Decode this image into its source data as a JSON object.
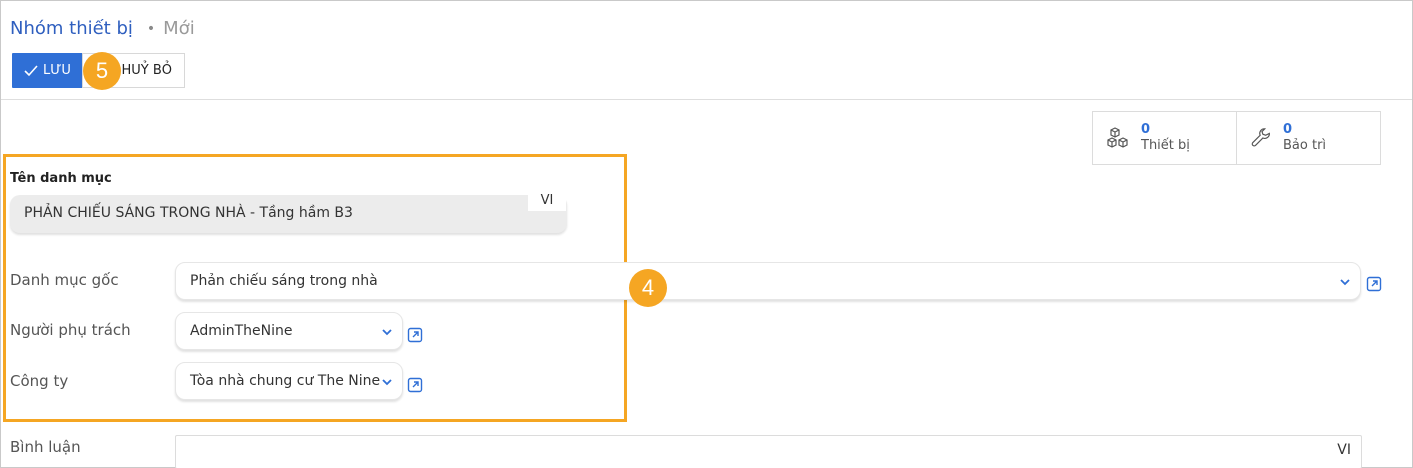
{
  "breadcrumb": {
    "root": "Nhóm thiết bị",
    "separator": "•",
    "current": "Mới"
  },
  "toolbar": {
    "save_label": "LƯU",
    "cancel_label": "HUỶ BỎ"
  },
  "annotations": {
    "step_toolbar": "5",
    "step_form": "4"
  },
  "stats": {
    "devices": {
      "count": "0",
      "label": "Thiết bị",
      "icon": "cubes-icon"
    },
    "maintenance": {
      "count": "0",
      "label": "Bảo trì",
      "icon": "wrench-icon"
    }
  },
  "form": {
    "name_label": "Tên danh mục",
    "name_value": "PHẢN CHIẾU SÁNG TRONG NHÀ - Tầng hầm B3",
    "name_lang": "VI",
    "parent_label": "Danh mục gốc",
    "parent_value": "Phản chiếu sáng trong nhà",
    "owner_label": "Người phụ trách",
    "owner_value": "AdminTheNine",
    "company_label": "Công ty",
    "company_value": "Tòa nhà chung cư The Nine",
    "comment_label": "Bình luận",
    "comment_value": "",
    "comment_lang": "VI"
  },
  "colors": {
    "accent": "#2f6fd6",
    "annotation": "#f5a623",
    "link": "#2f5fbf"
  }
}
